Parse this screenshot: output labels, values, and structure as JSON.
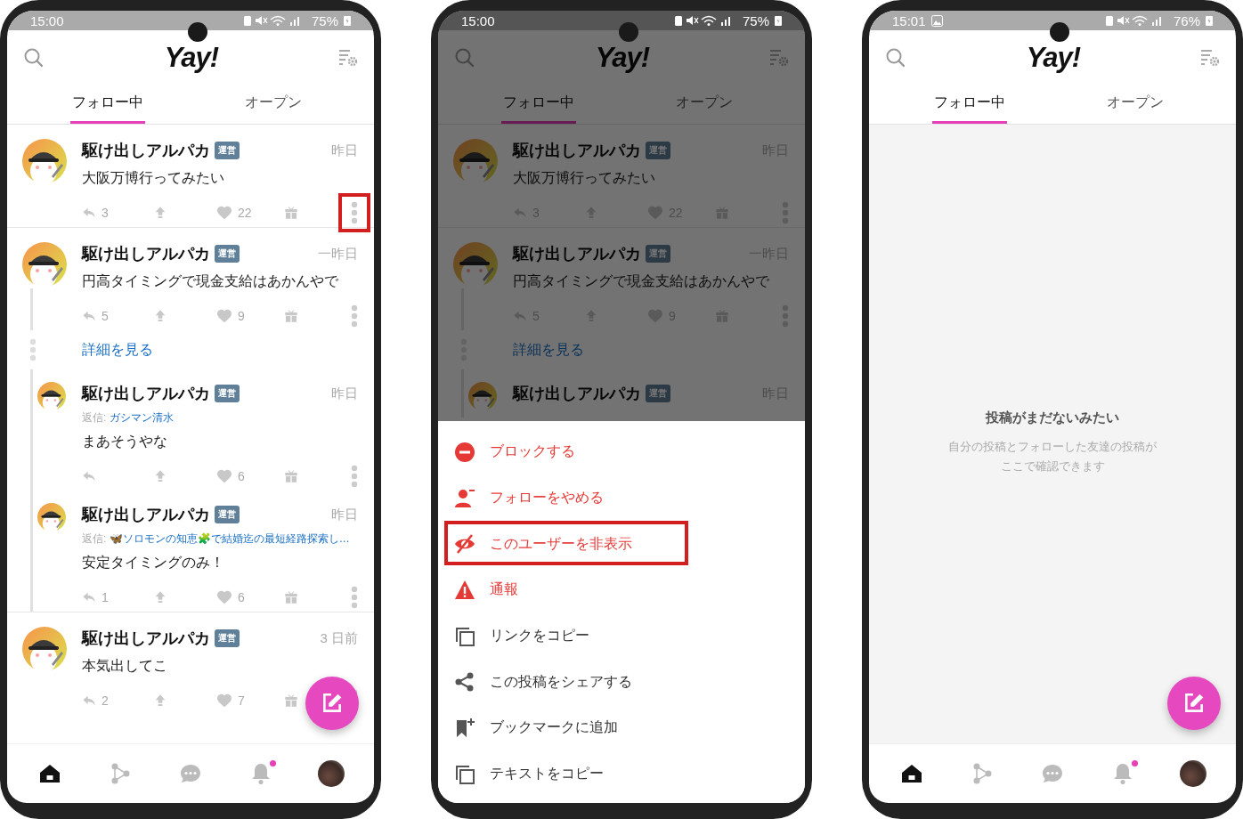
{
  "phones": [
    {
      "status_bar": {
        "time": "15:00",
        "notification_icon": false,
        "battery": "75%"
      },
      "header": {
        "logo": "Yay!"
      },
      "tabs": [
        {
          "label": "フォロー中",
          "selected": true
        },
        {
          "label": "オープン",
          "selected": false
        }
      ],
      "dimmed": false,
      "feed": [
        {
          "name": "駆け出しアルパカ",
          "badge": "運営",
          "time": "昨日",
          "text": "大阪万博行ってみたい",
          "replies": "3",
          "likes": "22",
          "more_highlighted": true
        },
        {
          "name": "駆け出しアルパカ",
          "badge": "運営",
          "time": "一昨日",
          "text": "円高タイミングで現金支給はあかんやで",
          "replies": "5",
          "likes": "9",
          "more_highlighted": false,
          "more_link": "詳細を見る",
          "children": [
            {
              "name": "駆け出しアルパカ",
              "badge": "運営",
              "time": "昨日",
              "reply_prefix": "返信:",
              "reply_to": "ガシマン清水",
              "text": "まあそうやな",
              "likes": "6",
              "more_highlighted": false
            },
            {
              "name": "駆け出しアルパカ",
              "badge": "運営",
              "time": "昨日",
              "reply_prefix": "返信:",
              "reply_to": "🦋ソロモンの知恵🧩で結婚迄の最短経路探索し…",
              "text": "安定タイミングのみ！",
              "replies": "1",
              "likes": "6",
              "more_highlighted": false
            }
          ]
        },
        {
          "name": "駆け出しアルパカ",
          "badge": "運営",
          "time": "3 日前",
          "text": "本気出してこ",
          "replies": "2",
          "likes": "7",
          "more_highlighted": false
        }
      ],
      "fab": true,
      "nav": [
        {
          "selected": true,
          "dot": false
        },
        {
          "selected": false,
          "dot": false
        },
        {
          "selected": false,
          "dot": false
        },
        {
          "selected": false,
          "dot": true
        },
        {
          "selected": false,
          "dot": false
        }
      ]
    },
    {
      "status_bar": {
        "time": "15:00",
        "notification_icon": false,
        "battery": "75%"
      },
      "header": {
        "logo": "Yay!"
      },
      "tabs": [
        {
          "label": "フォロー中",
          "selected": true
        },
        {
          "label": "オープン",
          "selected": false
        }
      ],
      "dimmed": true,
      "feed": [
        {
          "name": "駆け出しアルパカ",
          "badge": "運営",
          "time": "昨日",
          "text": "大阪万博行ってみたい",
          "replies": "3",
          "likes": "22",
          "more_highlighted": false
        },
        {
          "name": "駆け出しアルパカ",
          "badge": "運営",
          "time": "一昨日",
          "text": "円高タイミングで現金支給はあかんやで",
          "replies": "5",
          "likes": "9",
          "more_highlighted": false,
          "more_link": "詳細を見る",
          "children": [
            {
              "name": "駆け出しアルパカ",
              "badge": "運営",
              "time": "昨日"
            }
          ]
        }
      ],
      "fab": false,
      "menu": {
        "items": [
          {
            "label": "ブロックする",
            "kind": "danger",
            "highlighted": false
          },
          {
            "label": "フォローをやめる",
            "kind": "danger",
            "highlighted": false
          },
          {
            "label": "このユーザーを非表示",
            "kind": "danger",
            "highlighted": true
          },
          {
            "label": "通報",
            "kind": "danger",
            "highlighted": false
          },
          {
            "label": "リンクをコピー",
            "kind": "normal",
            "highlighted": false
          },
          {
            "label": "この投稿をシェアする",
            "kind": "normal",
            "highlighted": false
          },
          {
            "label": "ブックマークに追加",
            "kind": "normal",
            "highlighted": false
          },
          {
            "label": "テキストをコピー",
            "kind": "normal",
            "highlighted": false
          }
        ]
      }
    },
    {
      "status_bar": {
        "time": "15:01",
        "notification_icon": true,
        "battery": "76%"
      },
      "header": {
        "logo": "Yay!"
      },
      "tabs": [
        {
          "label": "フォロー中",
          "selected": true
        },
        {
          "label": "オープン",
          "selected": false
        }
      ],
      "dimmed": false,
      "empty": {
        "title": "投稿がまだないみたい",
        "message": "自分の投稿とフォローした友達の投稿がここで確認できます"
      },
      "fab": true,
      "nav": [
        {
          "selected": true,
          "dot": false
        },
        {
          "selected": false,
          "dot": false
        },
        {
          "selected": false,
          "dot": false
        },
        {
          "selected": false,
          "dot": true
        },
        {
          "selected": false,
          "dot": false
        }
      ]
    }
  ]
}
